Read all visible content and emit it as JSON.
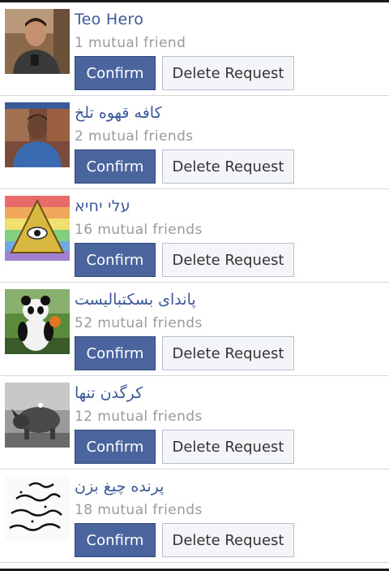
{
  "friend_requests": [
    {
      "name": "Teo Hero",
      "mutual": "1 mutual friend",
      "avatar_icon": "profile-photo-man-selfie"
    },
    {
      "name": "کافه قهوه تلخ",
      "mutual": "2 mutual friends",
      "avatar_icon": "profile-photo-man"
    },
    {
      "name": "עלי יחיא",
      "mutual": "16 mutual friends",
      "avatar_icon": "profile-photo-eye-pyramid"
    },
    {
      "name": "پاندای بسکتبالیست",
      "mutual": "52 mutual friends",
      "avatar_icon": "profile-photo-panda"
    },
    {
      "name": "کرگدن تنها",
      "mutual": "12 mutual friends",
      "avatar_icon": "profile-photo-rhino"
    },
    {
      "name": "پرنده چیغ بزن",
      "mutual": "18 mutual friends",
      "avatar_icon": "profile-photo-handwritten-text"
    }
  ],
  "buttons": {
    "confirm": "Confirm",
    "delete": "Delete Request"
  },
  "colors": {
    "name": "#3b5998",
    "confirm_bg": "#4a649e",
    "mutual": "#9a9a9a"
  }
}
